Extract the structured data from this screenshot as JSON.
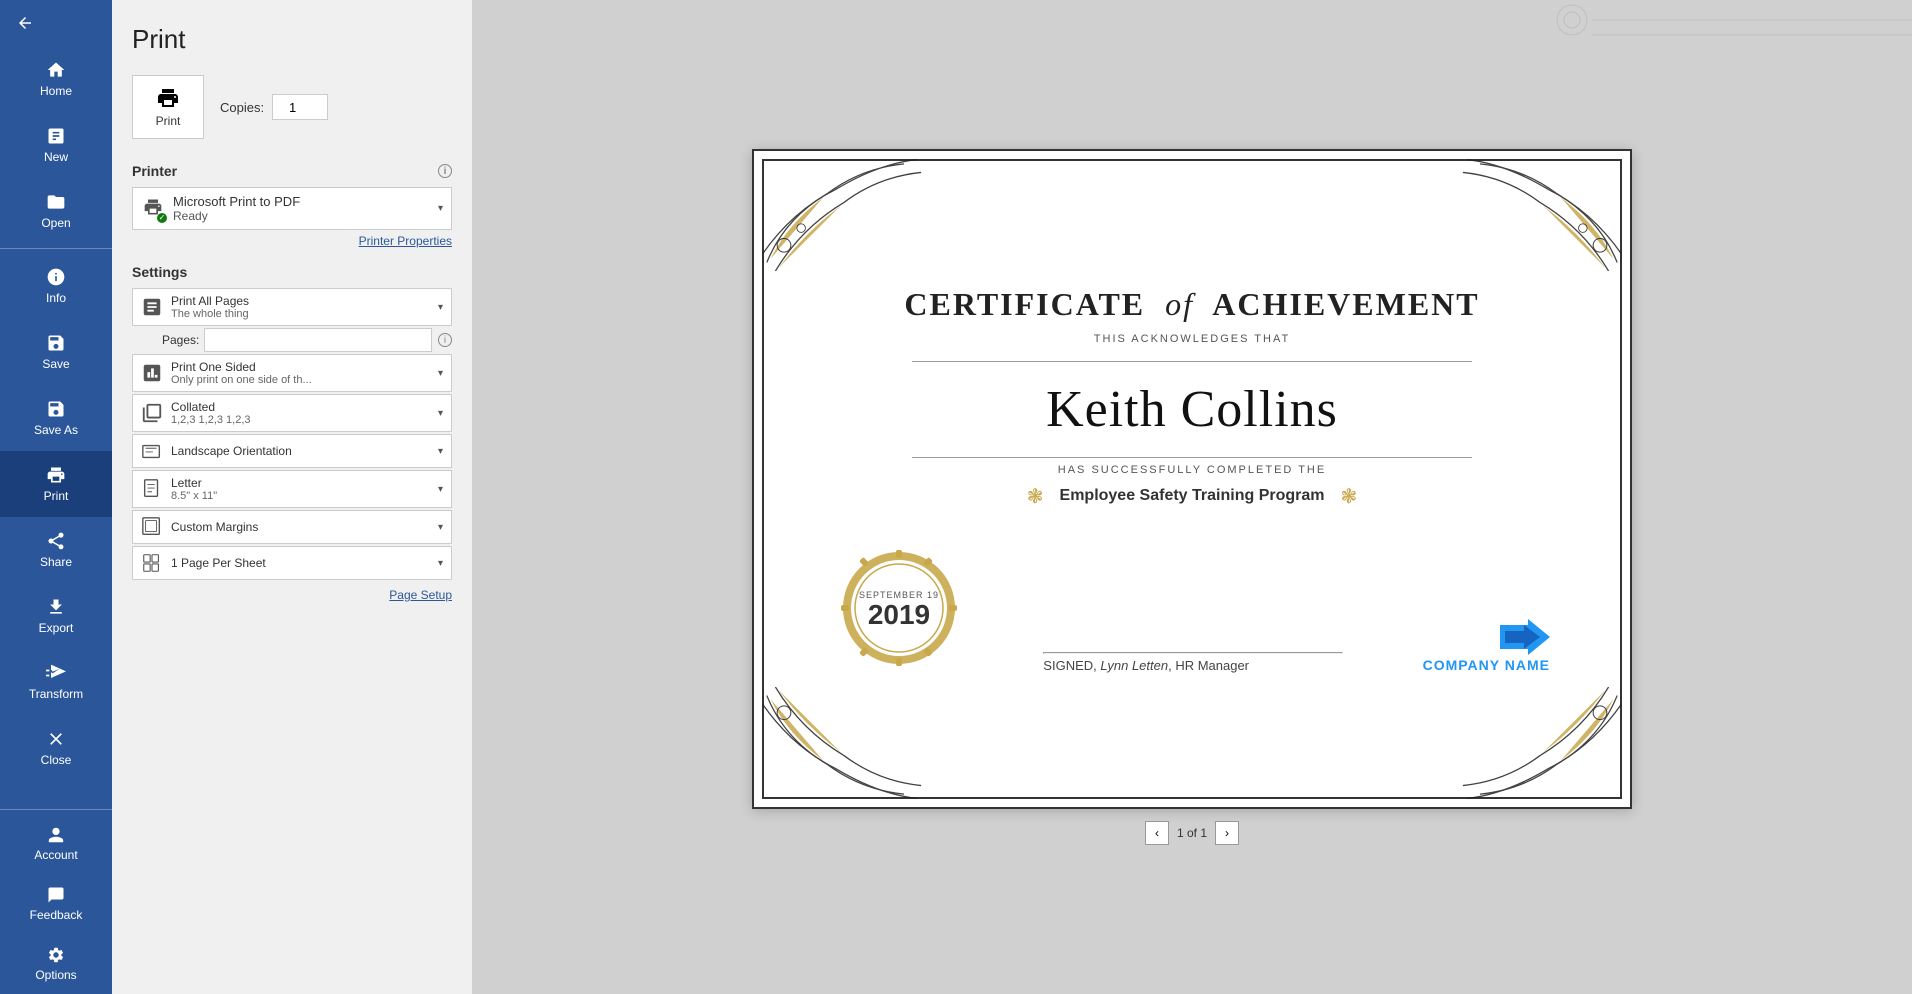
{
  "app": {
    "title": "Print"
  },
  "sidebar": {
    "back_label": "",
    "items": [
      {
        "id": "home",
        "label": "Home"
      },
      {
        "id": "new",
        "label": "New"
      },
      {
        "id": "open",
        "label": "Open"
      }
    ],
    "middle_items": [
      {
        "id": "info",
        "label": "Info"
      },
      {
        "id": "save",
        "label": "Save"
      },
      {
        "id": "save-as",
        "label": "Save As"
      },
      {
        "id": "print",
        "label": "Print",
        "active": true
      },
      {
        "id": "share",
        "label": "Share"
      },
      {
        "id": "export",
        "label": "Export"
      },
      {
        "id": "transform",
        "label": "Transform"
      },
      {
        "id": "close",
        "label": "Close"
      }
    ],
    "bottom_items": [
      {
        "id": "account",
        "label": "Account"
      },
      {
        "id": "feedback",
        "label": "Feedback"
      },
      {
        "id": "options",
        "label": "Options"
      }
    ]
  },
  "print": {
    "title": "Print",
    "print_button_label": "Print",
    "copies_label": "Copies:",
    "copies_value": "1",
    "printer": {
      "section_label": "Printer",
      "name": "Microsoft Print to PDF",
      "status": "Ready",
      "properties_label": "Printer Properties"
    },
    "settings": {
      "section_label": "Settings",
      "pages_label": "Pages:",
      "pages_placeholder": "",
      "rows": [
        {
          "id": "print-range",
          "main": "Print All Pages",
          "sub": "The whole thing"
        },
        {
          "id": "duplex",
          "main": "Print One Sided",
          "sub": "Only print on one side of th..."
        },
        {
          "id": "collate",
          "main": "Collated",
          "sub": "1,2,3   1,2,3   1,2,3"
        },
        {
          "id": "orientation",
          "main": "Landscape Orientation",
          "sub": ""
        },
        {
          "id": "paper-size",
          "main": "Letter",
          "sub": "8.5\" x 11\""
        },
        {
          "id": "margins",
          "main": "Custom Margins",
          "sub": ""
        },
        {
          "id": "pages-per-sheet",
          "main": "1 Page Per Sheet",
          "sub": ""
        }
      ],
      "page_setup_label": "Page Setup"
    }
  },
  "certificate": {
    "title_part1": "CERTIFICATE",
    "title_italic": "of",
    "title_part2": "ACHIEVEMENT",
    "acknowledges": "THIS ACKNOWLEDGES THAT",
    "recipient": "Keith Collins",
    "completed_text": "HAS SUCCESSFULLY COMPLETED THE",
    "program": "Employee Safety Training Program",
    "seal_month": "SEPTEMBER 19",
    "seal_year": "2019",
    "sig_text": "SIGNED, Lynn Letten, HR Manager",
    "company_name": "COMPANY NAME"
  },
  "pagination": {
    "current": "1",
    "total": "1"
  },
  "colors": {
    "sidebar_bg": "#2b579a",
    "active_item_bg": "#1a3f7a",
    "gold": "#c8a84b",
    "blue": "#2196f3",
    "link": "#2b579a"
  }
}
